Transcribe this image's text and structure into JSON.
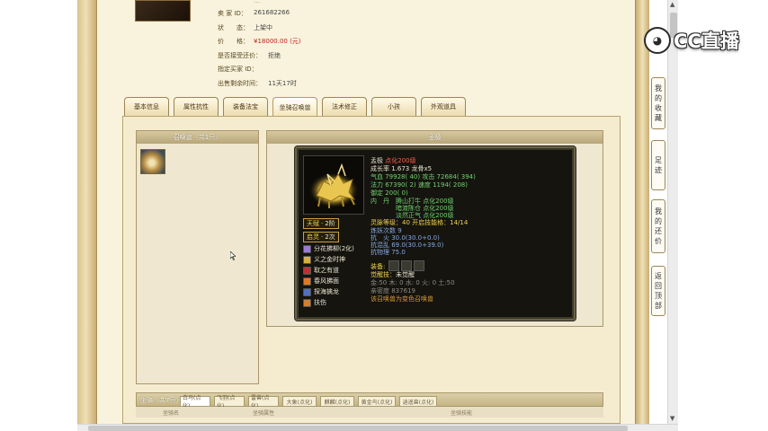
{
  "seller_info": {
    "id_partial": "…",
    "rows": [
      {
        "label": "卖 家 ID：",
        "value": "261682266"
      },
      {
        "label": "状　　态：",
        "value": "上架中"
      },
      {
        "label": "价　　格：",
        "value": "¥18000.00 (元)"
      },
      {
        "label": "是否接受还价：",
        "value": "拒绝"
      },
      {
        "label": "指定买家 ID：",
        "value": ""
      },
      {
        "label": "出售剩余时间：",
        "value": "11天17时"
      }
    ]
  },
  "tabs": [
    "基本信息",
    "属性抗性",
    "装备法宝",
    "坐骑召唤兽",
    "法术修正",
    "小孩",
    "外观道具"
  ],
  "active_tab_index": 3,
  "list_panel": {
    "title": "召唤兽（共1只）"
  },
  "detail_panel": {
    "title": "孟极"
  },
  "pet": {
    "name_line": {
      "name": "孟极",
      "note": "点化200级"
    },
    "growth": "成长率 1.673 龙骨x5",
    "hp_line": {
      "l1": "气血 79928( 40)",
      "l2": "攻击 72684( 394)"
    },
    "mp_line": {
      "l1": "法力 67390( 2)",
      "l2": "速度 1194( 208)"
    },
    "defense": "御定 200( 0)",
    "dan": {
      "label": "内　丹",
      "lines": [
        "腾山打牛 点化200级",
        "暗渡陈仓 点化200级",
        "淡然正气 点化200级"
      ]
    },
    "spirit": "灵脉等级：40 开启技能格：14/14",
    "train": "炼妖次数 9",
    "resist": [
      "抗　火 30.0(30.0+0.0)",
      "抗混乱 69.0(30.0+39.0)",
      "抗物理 75.0"
    ],
    "tianfu": {
      "label": "天赋",
      "value": "2阶"
    },
    "qiling": {
      "label": "启灵",
      "value": "2次"
    },
    "skills": [
      {
        "name": "分花拂柳(2化)",
        "color": "#9a7ad8"
      },
      {
        "name": "义之金时神",
        "color": "#d8b040"
      },
      {
        "name": "取之有道",
        "color": "#c03030"
      },
      {
        "name": "春风拂面",
        "color": "#e07a20"
      },
      {
        "name": "探海擒龙",
        "color": "#5070c0"
      },
      {
        "name": "扶伤",
        "color": "#d08030"
      }
    ],
    "equip_label": "装备:",
    "awaken": {
      "label": "觉醒技：",
      "value": "未觉醒"
    },
    "elements": "金:50 木: 0 水: 0 火: 0 土:50",
    "dispel": "亲密度 837619",
    "note": "该召唤兽为变色召唤兽"
  },
  "bottom": {
    "label": "坐骑（共7只）",
    "tabs": [
      "白马(点化)",
      "飞羽(点化)",
      "雷兽(点化)",
      "大象(点化)",
      "麒麟(点化)",
      "黄金鸟(点化)",
      "逍遥兽(点化)"
    ],
    "subhead": [
      "坐骑名",
      "坐骑属性",
      "坐骑技能"
    ]
  },
  "side_nav": [
    "我的收藏",
    "足迹",
    "我的还价",
    "返回顶部"
  ],
  "logo": {
    "text": "CC直播"
  },
  "colors": {
    "accent": "#c32020",
    "frame": "#d9c28d"
  }
}
